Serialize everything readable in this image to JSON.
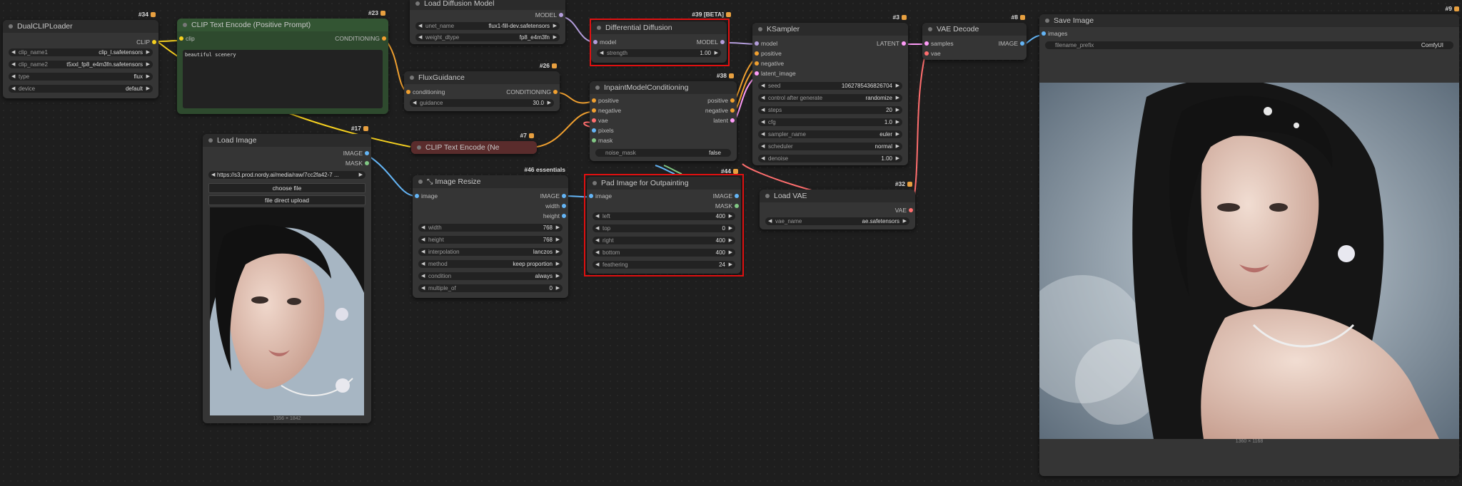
{
  "nodes": {
    "dualclip": {
      "title": "DualCLIPLoader",
      "id": "#34",
      "out_clip": "CLIP",
      "w": [
        {
          "label": "clip_name1",
          "value": "clip_l.safetensors"
        },
        {
          "label": "clip_name2",
          "value": "t5xxl_fp8_e4m3fn.safetensors"
        },
        {
          "label": "type",
          "value": "flux"
        },
        {
          "label": "device",
          "value": "default"
        }
      ]
    },
    "cliptext": {
      "title": "CLIP Text Encode (Positive Prompt)",
      "id": "#23",
      "in_clip": "clip",
      "out": "CONDITIONING",
      "prompt": "beautiful scenery"
    },
    "loaddiff": {
      "title": "Load Diffusion Model",
      "out": "MODEL",
      "w": [
        {
          "label": "unet_name",
          "value": "flux1-fill-dev.safetensors"
        },
        {
          "label": "weight_dtype",
          "value": "fp8_e4m3fn"
        }
      ]
    },
    "diffdiff": {
      "title": "Differential Diffusion",
      "id": "#39 [BETA]",
      "in": "model",
      "out": "MODEL",
      "w": [
        {
          "label": "strength",
          "value": "1.00"
        }
      ]
    },
    "ksampler": {
      "title": "KSampler",
      "id": "#3",
      "inputs": [
        "model",
        "positive",
        "negative",
        "latent_image"
      ],
      "out": "LATENT",
      "w": [
        {
          "label": "seed",
          "value": "1062785436826704"
        },
        {
          "label": "control after generate",
          "value": "randomize"
        },
        {
          "label": "steps",
          "value": "20"
        },
        {
          "label": "cfg",
          "value": "1.0"
        },
        {
          "label": "sampler_name",
          "value": "euler"
        },
        {
          "label": "scheduler",
          "value": "normal"
        },
        {
          "label": "denoise",
          "value": "1.00"
        }
      ]
    },
    "vaedecode": {
      "title": "VAE Decode",
      "id": "#8",
      "inputs": [
        "samples",
        "vae"
      ],
      "out": "IMAGE"
    },
    "saveimage": {
      "title": "Save Image",
      "id": "#9",
      "in": "images",
      "w": [
        {
          "label": "filename_prefix",
          "value": "ComfyUI"
        }
      ],
      "caption": "1360 × 1168"
    },
    "flux": {
      "title": "FluxGuidance",
      "id": "#26",
      "in": "conditioning",
      "out": "CONDITIONING",
      "w": [
        {
          "label": "guidance",
          "value": "30.0"
        }
      ]
    },
    "inpaint": {
      "title": "InpaintModelConditioning",
      "id": "#38",
      "inputs": [
        "positive",
        "negative",
        "vae",
        "pixels",
        "mask"
      ],
      "outputs": [
        "positive",
        "negative",
        "latent"
      ],
      "w": [
        {
          "label": "noise_mask",
          "value": "false"
        }
      ]
    },
    "cliptextneg": {
      "title": "CLIP Text Encode (Ne",
      "id": "#7"
    },
    "loadimage": {
      "title": "Load Image",
      "id": "#17",
      "outputs": [
        "IMAGE",
        "MASK"
      ],
      "w": [
        {
          "label": "",
          "value": "https://s3.prod.nordy.ai/media/raw/7cc2fa42-7 ..."
        }
      ],
      "btn_choose": "choose file",
      "btn_upload": "file direct upload",
      "caption": "1356 × 1842"
    },
    "resize": {
      "title": "Image Resize",
      "id": "#46 essentials",
      "in": "image",
      "outputs": [
        "IMAGE",
        "width",
        "height"
      ],
      "w": [
        {
          "label": "width",
          "value": "768"
        },
        {
          "label": "height",
          "value": "768"
        },
        {
          "label": "interpolation",
          "value": "lanczos"
        },
        {
          "label": "method",
          "value": "keep proportion"
        },
        {
          "label": "condition",
          "value": "always"
        },
        {
          "label": "multiple_of",
          "value": "0"
        }
      ]
    },
    "pad": {
      "title": "Pad Image for Outpainting",
      "id": "#44",
      "in": "image",
      "outputs": [
        "IMAGE",
        "MASK"
      ],
      "w": [
        {
          "label": "left",
          "value": "400"
        },
        {
          "label": "top",
          "value": "0"
        },
        {
          "label": "right",
          "value": "400"
        },
        {
          "label": "bottom",
          "value": "400"
        },
        {
          "label": "feathering",
          "value": "24"
        }
      ]
    },
    "loadvae": {
      "title": "Load VAE",
      "id": "#32",
      "out": "VAE",
      "w": [
        {
          "label": "vae_name",
          "value": "ae.safetensors"
        }
      ]
    }
  },
  "colors": {
    "clip": "#f5d020",
    "cond": "#f0a030",
    "model": "#b39ddb",
    "latent": "#ff9cf9",
    "vae": "#ff6e6e",
    "image": "#64b5f6",
    "mask": "#81c784",
    "highlight": "#e01010"
  }
}
